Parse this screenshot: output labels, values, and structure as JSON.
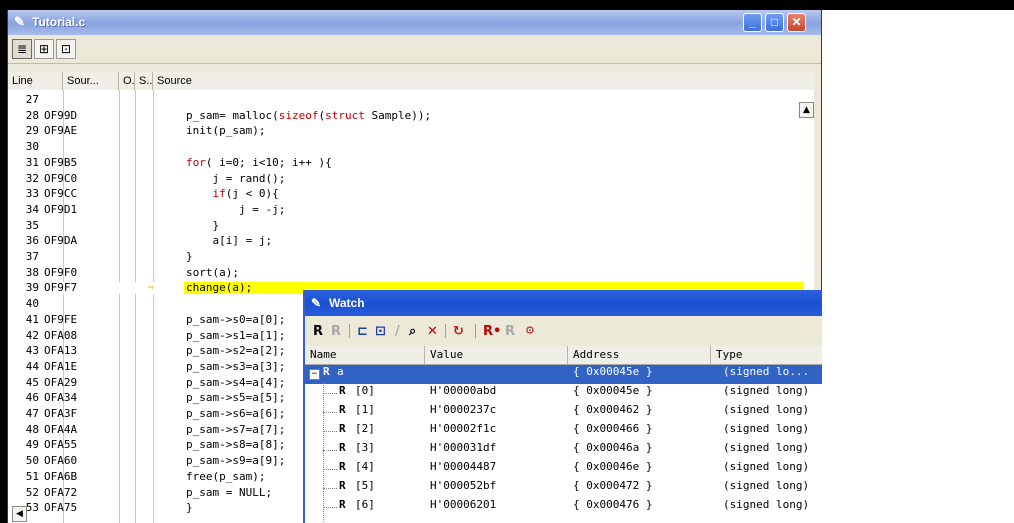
{
  "editor": {
    "title": "Tutorial.c",
    "columns": [
      "Line",
      "Sour...",
      "O..",
      "S..",
      "Source"
    ],
    "breakpoint_marker": "⇨",
    "rows": [
      {
        "line": "27",
        "addr": "",
        "src": ""
      },
      {
        "line": "28",
        "addr": "OF99D",
        "src": "p_sam= malloc(sizeof(struct Sample));"
      },
      {
        "line": "29",
        "addr": "OF9AE",
        "src": "init(p_sam);"
      },
      {
        "line": "30",
        "addr": "",
        "src": ""
      },
      {
        "line": "31",
        "addr": "OF9B5",
        "src": "for( i=0; i<10; i++ ){"
      },
      {
        "line": "32",
        "addr": "OF9C0",
        "src": "    j = rand();"
      },
      {
        "line": "33",
        "addr": "OF9CC",
        "src": "    if(j < 0){"
      },
      {
        "line": "34",
        "addr": "OF9D1",
        "src": "        j = -j;"
      },
      {
        "line": "35",
        "addr": "",
        "src": "    }"
      },
      {
        "line": "36",
        "addr": "OF9DA",
        "src": "    a[i] = j;"
      },
      {
        "line": "37",
        "addr": "",
        "src": "}"
      },
      {
        "line": "38",
        "addr": "OF9F0",
        "src": "sort(a);"
      },
      {
        "line": "39",
        "addr": "OF9F7",
        "src": "change(a);"
      },
      {
        "line": "40",
        "addr": "",
        "src": ""
      },
      {
        "line": "41",
        "addr": "OF9FE",
        "src": "p_sam->s0=a[0];"
      },
      {
        "line": "42",
        "addr": "OFA08",
        "src": "p_sam->s1=a[1];"
      },
      {
        "line": "43",
        "addr": "OFA13",
        "src": "p_sam->s2=a[2];"
      },
      {
        "line": "44",
        "addr": "OFA1E",
        "src": "p_sam->s3=a[3];"
      },
      {
        "line": "45",
        "addr": "OFA29",
        "src": "p_sam->s4=a[4];"
      },
      {
        "line": "46",
        "addr": "OFA34",
        "src": "p_sam->s5=a[5];"
      },
      {
        "line": "47",
        "addr": "OFA3F",
        "src": "p_sam->s6=a[6];"
      },
      {
        "line": "48",
        "addr": "OFA4A",
        "src": "p_sam->s7=a[7];"
      },
      {
        "line": "49",
        "addr": "OFA55",
        "src": "p_sam->s8=a[8];"
      },
      {
        "line": "50",
        "addr": "OFA60",
        "src": "p_sam->s9=a[9];"
      },
      {
        "line": "51",
        "addr": "OFA6B",
        "src": "free(p_sam);"
      },
      {
        "line": "52",
        "addr": "OFA72",
        "src": "p_sam = NULL;"
      },
      {
        "line": "53",
        "addr": "OFA75",
        "src": "}"
      }
    ]
  },
  "watch": {
    "title": "Watch",
    "columns": [
      "Name",
      "Value",
      "Address",
      "Type"
    ],
    "root": {
      "name": "a",
      "value": "",
      "address": "{ 0x00045e }",
      "type": "(signed lo..."
    },
    "items": [
      {
        "name": "[0]",
        "value": "H'00000abd",
        "address": "{ 0x00045e }",
        "type": "(signed long)"
      },
      {
        "name": "[1]",
        "value": "H'0000237c",
        "address": "{ 0x000462 }",
        "type": "(signed long)"
      },
      {
        "name": "[2]",
        "value": "H'00002f1c",
        "address": "{ 0x000466 }",
        "type": "(signed long)"
      },
      {
        "name": "[3]",
        "value": "H'000031df",
        "address": "{ 0x00046a }",
        "type": "(signed long)"
      },
      {
        "name": "[4]",
        "value": "H'00004487",
        "address": "{ 0x00046e }",
        "type": "(signed long)"
      },
      {
        "name": "[5]",
        "value": "H'000052bf",
        "address": "{ 0x000472 }",
        "type": "(signed long)"
      },
      {
        "name": "[6]",
        "value": "H'00006201",
        "address": "{ 0x000476 }",
        "type": "(signed long)"
      }
    ]
  },
  "colors": {
    "current_line": "#ffff00",
    "keyword": "#c00000",
    "selection": "#3163c5"
  },
  "icons": [
    "file-icon",
    "source-view-icon",
    "mixed-view-icon",
    "register-icon",
    "minimize-icon",
    "maximize-icon",
    "close-icon"
  ]
}
